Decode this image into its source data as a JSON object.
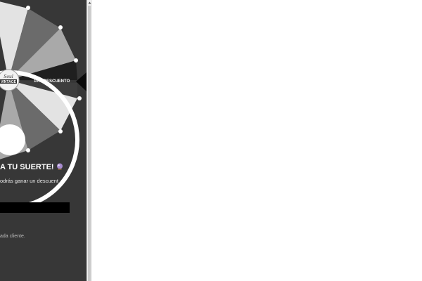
{
  "popup": {
    "logo": {
      "line1": "Soul",
      "line2": "VINTAGE"
    },
    "wheel": {
      "visible_label": "10% DESCUENTO",
      "colors": {
        "light": "#e3e3e3",
        "dark": "#6b6b6b",
        "mid": "#a9a9a9"
      }
    },
    "title": "A TU SUERTE!",
    "title_icon": "crystal-ball-icon",
    "subtitle": "odrás ganar un descuent",
    "email_placeholder": "",
    "footnote": "ada cliente."
  },
  "colors": {
    "panel_bg": "#373737",
    "page_bg": "#ffffff",
    "input_bg": "#000000"
  }
}
